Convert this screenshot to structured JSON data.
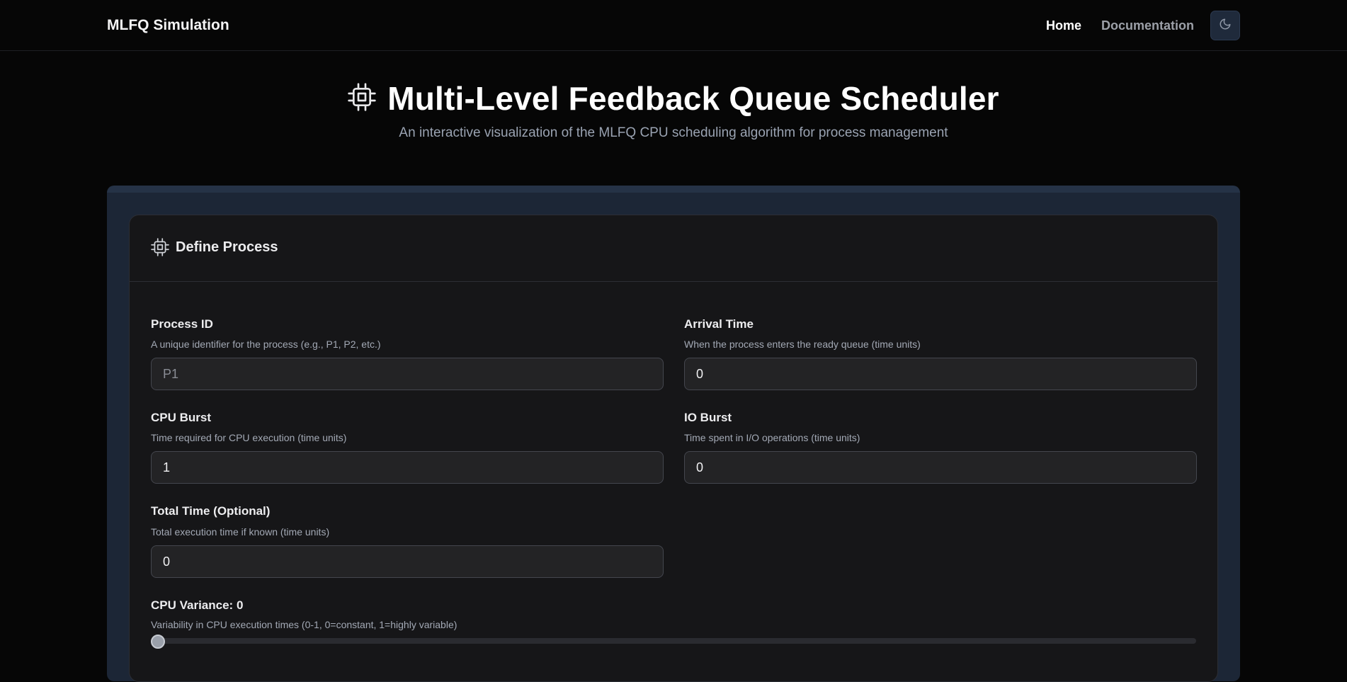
{
  "nav": {
    "brand": "MLFQ Simulation",
    "home": "Home",
    "documentation": "Documentation",
    "theme_icon": "moon-icon"
  },
  "hero": {
    "title": "Multi-Level Feedback Queue Scheduler",
    "subtitle": "An interactive visualization of the MLFQ CPU scheduling algorithm for process management",
    "icon": "cpu-icon"
  },
  "card": {
    "title": "Define Process",
    "icon": "cpu-icon"
  },
  "form": {
    "process_id": {
      "label": "Process ID",
      "help": "A unique identifier for the process (e.g., P1, P2, etc.)",
      "value": "",
      "placeholder": "P1"
    },
    "arrival_time": {
      "label": "Arrival Time",
      "help": "When the process enters the ready queue (time units)",
      "value": "0"
    },
    "cpu_burst": {
      "label": "CPU Burst",
      "help": "Time required for CPU execution (time units)",
      "value": "1"
    },
    "io_burst": {
      "label": "IO Burst",
      "help": "Time spent in I/O operations (time units)",
      "value": "0"
    },
    "total_time": {
      "label": "Total Time (Optional)",
      "help": "Total execution time if known (time units)",
      "value": "0"
    },
    "cpu_variance": {
      "label": "CPU Variance: 0",
      "help": "Variability in CPU execution times (0-1, 0=constant, 1=highly variable)",
      "value": 0
    }
  },
  "colors": {
    "background": "#060606",
    "panel": "#1c2636",
    "card": "#161618",
    "accent_button": "#1f2a3b"
  }
}
